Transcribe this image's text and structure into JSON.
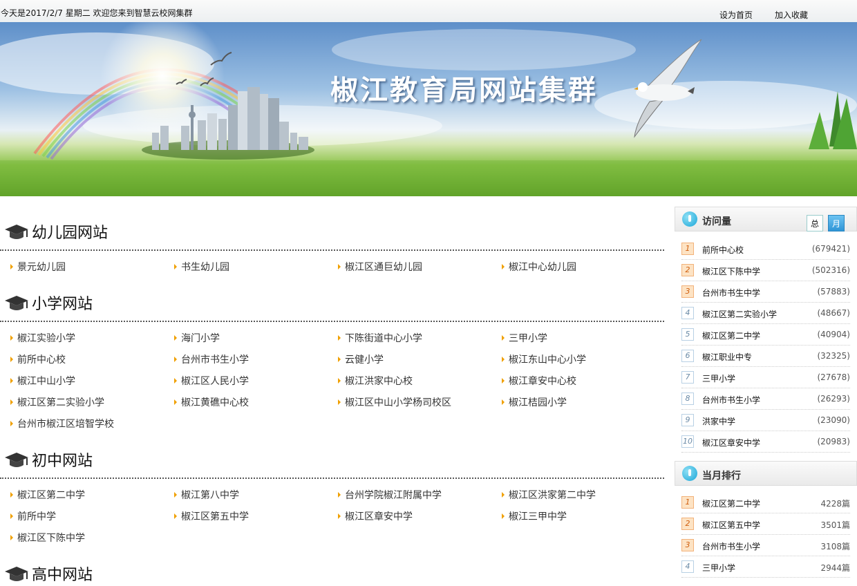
{
  "topbar": {
    "date_text": "今天是2017/2/7 星期二 欢迎您来到智慧云校网集群",
    "set_home": "设为首页",
    "add_favorite": "加入收藏"
  },
  "banner": {
    "title": "椒江教育局网站集群"
  },
  "sections": [
    {
      "title": "幼儿园网站",
      "links": [
        "景元幼儿园",
        "书生幼儿园",
        "椒江区通巨幼儿园",
        "椒江中心幼儿园"
      ]
    },
    {
      "title": "小学网站",
      "links": [
        "椒江实验小学",
        "海门小学",
        "下陈街道中心小学",
        "三甲小学",
        "前所中心校",
        "台州市书生小学",
        "云健小学",
        "椒江东山中心小学",
        "椒江中山小学",
        "椒江区人民小学",
        "椒江洪家中心校",
        "椒江章安中心校",
        "椒江区第二实验小学",
        "椒江黄礁中心校",
        "椒江区中山小学杨司校区",
        "椒江桔园小学",
        "台州市椒江区培智学校"
      ]
    },
    {
      "title": "初中网站",
      "links": [
        "椒江区第二中学",
        "椒江第八中学",
        "台州学院椒江附属中学",
        "椒江区洪家第二中学",
        "前所中学",
        "椒江区第五中学",
        "椒江区章安中学",
        "椒江三甲中学",
        "椒江区下陈中学"
      ]
    },
    {
      "title": "高中网站",
      "links": []
    }
  ],
  "visits": {
    "title": "访问量",
    "tab_total": "总",
    "tab_month": "月",
    "rows": [
      {
        "rank": "1",
        "name": "前所中心校",
        "count": "(679421)"
      },
      {
        "rank": "2",
        "name": "椒江区下陈中学",
        "count": "(502316)"
      },
      {
        "rank": "3",
        "name": "台州市书生中学",
        "count": "(57883)"
      },
      {
        "rank": "4",
        "name": "椒江区第二实验小学",
        "count": "(48667)"
      },
      {
        "rank": "5",
        "name": "椒江区第二中学",
        "count": "(40904)"
      },
      {
        "rank": "6",
        "name": "椒江职业中专",
        "count": "(32325)"
      },
      {
        "rank": "7",
        "name": "三甲小学",
        "count": "(27678)"
      },
      {
        "rank": "8",
        "name": "台州市书生小学",
        "count": "(26293)"
      },
      {
        "rank": "9",
        "name": "洪家中学",
        "count": "(23090)"
      },
      {
        "rank": "10",
        "name": "椒江区章安中学",
        "count": "(20983)"
      }
    ]
  },
  "monthly": {
    "title": "当月排行",
    "rows": [
      {
        "rank": "1",
        "name": "椒江区第二中学",
        "count": "4228篇"
      },
      {
        "rank": "2",
        "name": "椒江区第五中学",
        "count": "3501篇"
      },
      {
        "rank": "3",
        "name": "台州市书生小学",
        "count": "3108篇"
      },
      {
        "rank": "4",
        "name": "三甲小学",
        "count": "2944篇"
      }
    ]
  }
}
